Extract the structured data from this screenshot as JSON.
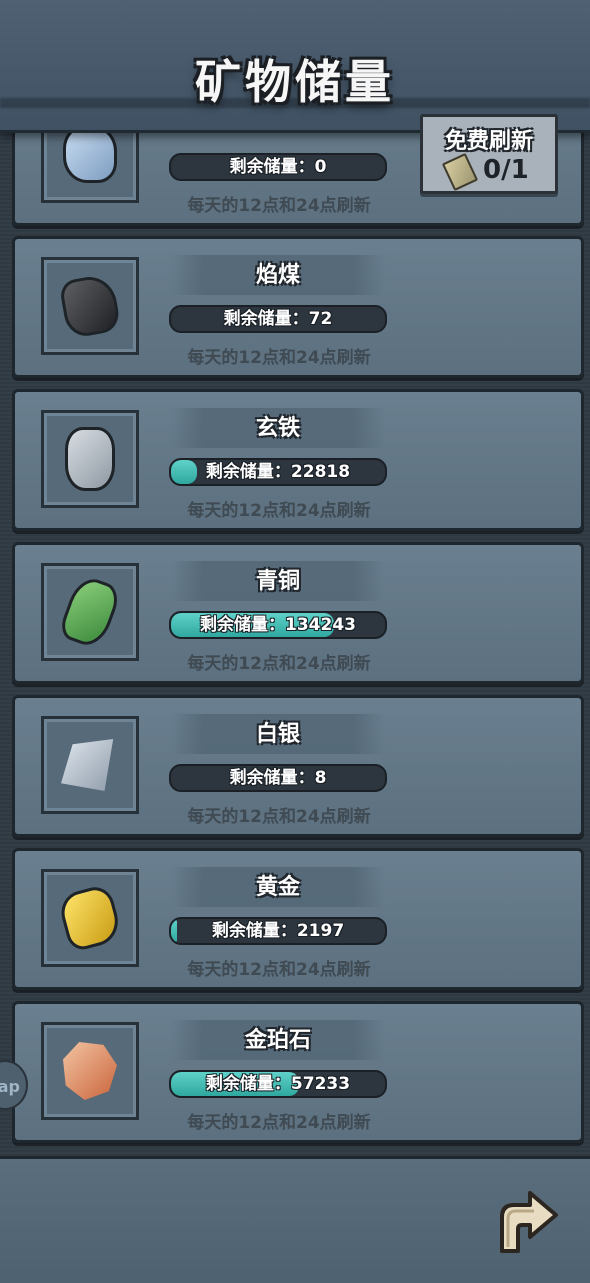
{
  "header": {
    "title": "矿物储量"
  },
  "free_refresh": {
    "label": "免费刷新",
    "count": "0/1"
  },
  "minerals": [
    {
      "name": "",
      "stock_label": "剩余储量：0",
      "fill_pct": 0,
      "note": "每天的12点和24点刷新",
      "icon": "blue-ore-icon"
    },
    {
      "name": "焰煤",
      "stock_label": "剩余储量：72",
      "fill_pct": 0,
      "note": "每天的12点和24点刷新",
      "icon": "coal-icon"
    },
    {
      "name": "玄铁",
      "stock_label": "剩余储量：22818",
      "fill_pct": 12,
      "note": "每天的12点和24点刷新",
      "icon": "iron-ore-icon"
    },
    {
      "name": "青铜",
      "stock_label": "剩余储量：134243",
      "fill_pct": 76,
      "note": "每天的12点和24点刷新",
      "icon": "bronze-ore-icon"
    },
    {
      "name": "白银",
      "stock_label": "剩余储量：8",
      "fill_pct": 0,
      "note": "每天的12点和24点刷新",
      "icon": "silver-ore-icon"
    },
    {
      "name": "黄金",
      "stock_label": "剩余储量：2197",
      "fill_pct": 3,
      "note": "每天的12点和24点刷新",
      "icon": "gold-ore-icon"
    },
    {
      "name": "金珀石",
      "stock_label": "剩余储量：57233",
      "fill_pct": 60,
      "note": "每天的12点和24点刷新",
      "icon": "amber-stone-icon"
    }
  ],
  "side_tab": {
    "label": "ap"
  },
  "colors": {
    "bar_fill": "#3fbcb2",
    "card_bg": "#63788a",
    "header_bg": "#46586a"
  }
}
